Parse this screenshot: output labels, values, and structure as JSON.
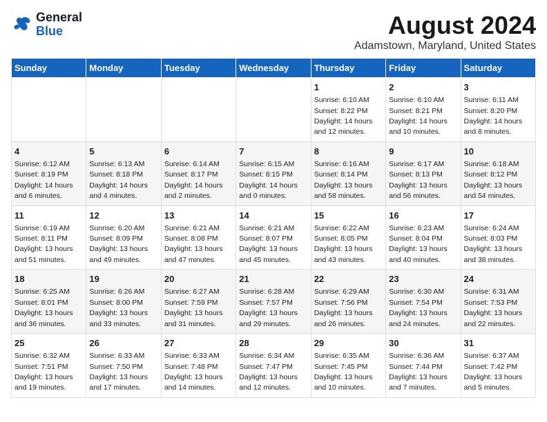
{
  "header": {
    "logo_line1": "General",
    "logo_line2": "Blue",
    "main_title": "August 2024",
    "subtitle": "Adamstown, Maryland, United States"
  },
  "days_of_week": [
    "Sunday",
    "Monday",
    "Tuesday",
    "Wednesday",
    "Thursday",
    "Friday",
    "Saturday"
  ],
  "weeks": [
    [
      {
        "day": "",
        "info": ""
      },
      {
        "day": "",
        "info": ""
      },
      {
        "day": "",
        "info": ""
      },
      {
        "day": "",
        "info": ""
      },
      {
        "day": "1",
        "info": "Sunrise: 6:10 AM\nSunset: 8:22 PM\nDaylight: 14 hours\nand 12 minutes."
      },
      {
        "day": "2",
        "info": "Sunrise: 6:10 AM\nSunset: 8:21 PM\nDaylight: 14 hours\nand 10 minutes."
      },
      {
        "day": "3",
        "info": "Sunrise: 6:11 AM\nSunset: 8:20 PM\nDaylight: 14 hours\nand 8 minutes."
      }
    ],
    [
      {
        "day": "4",
        "info": "Sunrise: 6:12 AM\nSunset: 8:19 PM\nDaylight: 14 hours\nand 6 minutes."
      },
      {
        "day": "5",
        "info": "Sunrise: 6:13 AM\nSunset: 8:18 PM\nDaylight: 14 hours\nand 4 minutes."
      },
      {
        "day": "6",
        "info": "Sunrise: 6:14 AM\nSunset: 8:17 PM\nDaylight: 14 hours\nand 2 minutes."
      },
      {
        "day": "7",
        "info": "Sunrise: 6:15 AM\nSunset: 8:15 PM\nDaylight: 14 hours\nand 0 minutes."
      },
      {
        "day": "8",
        "info": "Sunrise: 6:16 AM\nSunset: 8:14 PM\nDaylight: 13 hours\nand 58 minutes."
      },
      {
        "day": "9",
        "info": "Sunrise: 6:17 AM\nSunset: 8:13 PM\nDaylight: 13 hours\nand 56 minutes."
      },
      {
        "day": "10",
        "info": "Sunrise: 6:18 AM\nSunset: 8:12 PM\nDaylight: 13 hours\nand 54 minutes."
      }
    ],
    [
      {
        "day": "11",
        "info": "Sunrise: 6:19 AM\nSunset: 8:11 PM\nDaylight: 13 hours\nand 51 minutes."
      },
      {
        "day": "12",
        "info": "Sunrise: 6:20 AM\nSunset: 8:09 PM\nDaylight: 13 hours\nand 49 minutes."
      },
      {
        "day": "13",
        "info": "Sunrise: 6:21 AM\nSunset: 8:08 PM\nDaylight: 13 hours\nand 47 minutes."
      },
      {
        "day": "14",
        "info": "Sunrise: 6:21 AM\nSunset: 8:07 PM\nDaylight: 13 hours\nand 45 minutes."
      },
      {
        "day": "15",
        "info": "Sunrise: 6:22 AM\nSunset: 8:05 PM\nDaylight: 13 hours\nand 43 minutes."
      },
      {
        "day": "16",
        "info": "Sunrise: 6:23 AM\nSunset: 8:04 PM\nDaylight: 13 hours\nand 40 minutes."
      },
      {
        "day": "17",
        "info": "Sunrise: 6:24 AM\nSunset: 8:03 PM\nDaylight: 13 hours\nand 38 minutes."
      }
    ],
    [
      {
        "day": "18",
        "info": "Sunrise: 6:25 AM\nSunset: 8:01 PM\nDaylight: 13 hours\nand 36 minutes."
      },
      {
        "day": "19",
        "info": "Sunrise: 6:26 AM\nSunset: 8:00 PM\nDaylight: 13 hours\nand 33 minutes."
      },
      {
        "day": "20",
        "info": "Sunrise: 6:27 AM\nSunset: 7:59 PM\nDaylight: 13 hours\nand 31 minutes."
      },
      {
        "day": "21",
        "info": "Sunrise: 6:28 AM\nSunset: 7:57 PM\nDaylight: 13 hours\nand 29 minutes."
      },
      {
        "day": "22",
        "info": "Sunrise: 6:29 AM\nSunset: 7:56 PM\nDaylight: 13 hours\nand 26 minutes."
      },
      {
        "day": "23",
        "info": "Sunrise: 6:30 AM\nSunset: 7:54 PM\nDaylight: 13 hours\nand 24 minutes."
      },
      {
        "day": "24",
        "info": "Sunrise: 6:31 AM\nSunset: 7:53 PM\nDaylight: 13 hours\nand 22 minutes."
      }
    ],
    [
      {
        "day": "25",
        "info": "Sunrise: 6:32 AM\nSunset: 7:51 PM\nDaylight: 13 hours\nand 19 minutes."
      },
      {
        "day": "26",
        "info": "Sunrise: 6:33 AM\nSunset: 7:50 PM\nDaylight: 13 hours\nand 17 minutes."
      },
      {
        "day": "27",
        "info": "Sunrise: 6:33 AM\nSunset: 7:48 PM\nDaylight: 13 hours\nand 14 minutes."
      },
      {
        "day": "28",
        "info": "Sunrise: 6:34 AM\nSunset: 7:47 PM\nDaylight: 13 hours\nand 12 minutes."
      },
      {
        "day": "29",
        "info": "Sunrise: 6:35 AM\nSunset: 7:45 PM\nDaylight: 13 hours\nand 10 minutes."
      },
      {
        "day": "30",
        "info": "Sunrise: 6:36 AM\nSunset: 7:44 PM\nDaylight: 13 hours\nand 7 minutes."
      },
      {
        "day": "31",
        "info": "Sunrise: 6:37 AM\nSunset: 7:42 PM\nDaylight: 13 hours\nand 5 minutes."
      }
    ]
  ]
}
